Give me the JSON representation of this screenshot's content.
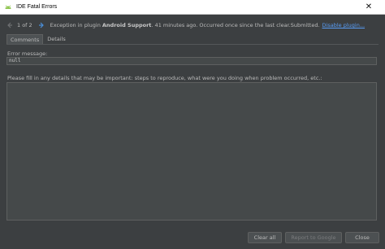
{
  "window": {
    "title": "IDE Fatal Errors",
    "close_glyph": "✕"
  },
  "nav": {
    "prev_icon": "arrow-left-icon",
    "counter": "1 of 2",
    "next_icon": "arrow-right-icon",
    "message_prefix": "Exception in plugin ",
    "plugin_name": "Android Support",
    "message_suffix": ". 41 minutes ago. Occurred once since the last clear.Submitted.",
    "disable_link": "Disable plugin..."
  },
  "tabs": [
    {
      "label": "Comments",
      "active": true
    },
    {
      "label": "Details",
      "active": false
    }
  ],
  "error": {
    "label": "Error message:",
    "value": "null"
  },
  "details": {
    "label": "Please fill in any details that may be important: steps to reproduce, what were you doing when problem occurred, etc.:",
    "value": ""
  },
  "buttons": {
    "clear_all": "Clear all",
    "report": "Report to Google",
    "close": "Close"
  },
  "colors": {
    "background": "#3c3f41",
    "link": "#589df6",
    "field": "#45494a"
  }
}
